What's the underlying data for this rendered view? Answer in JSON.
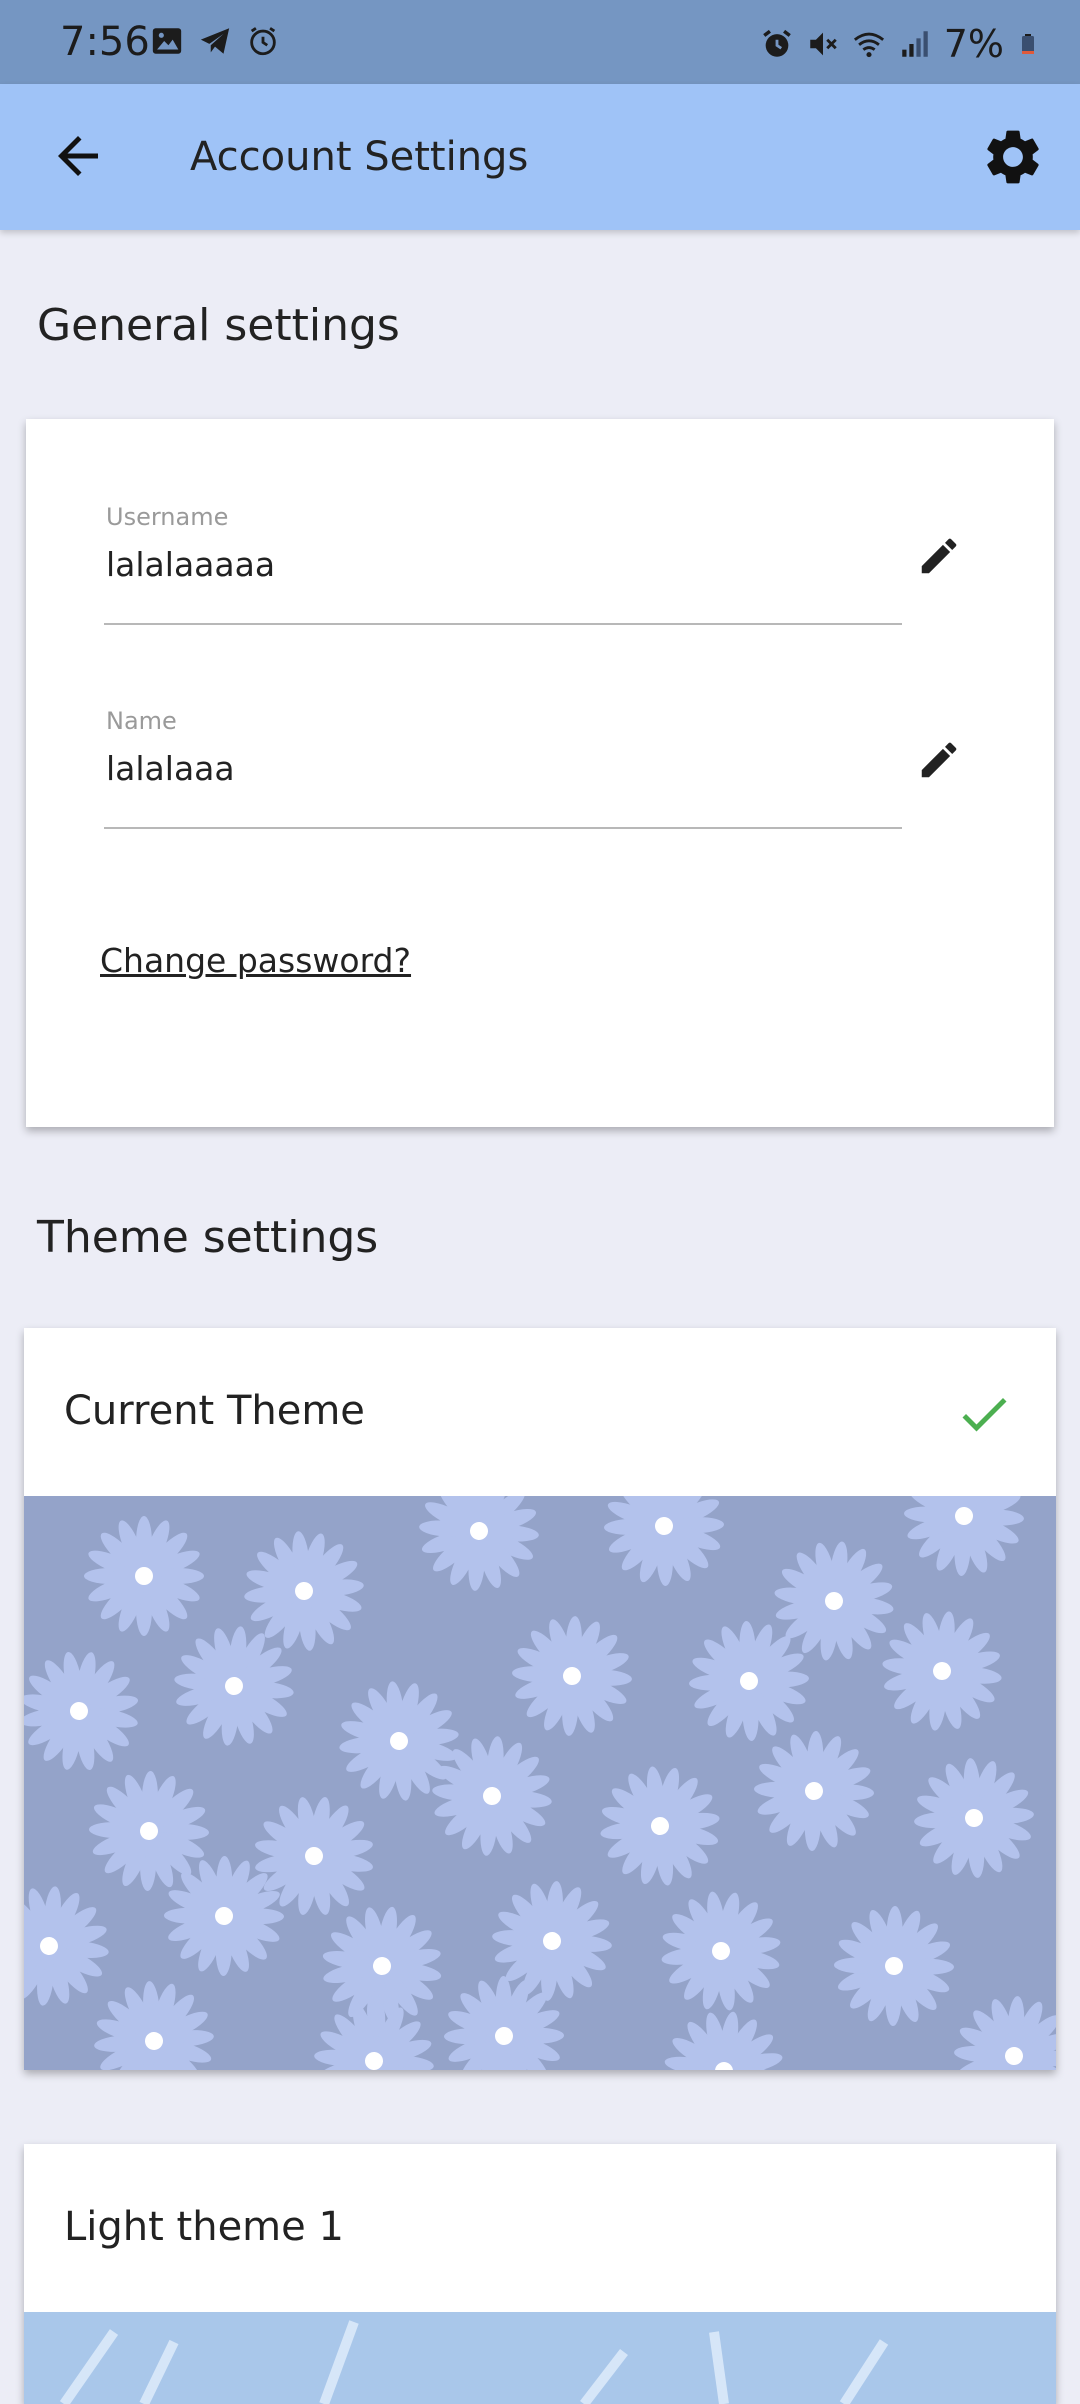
{
  "status_bar": {
    "time": "7:56",
    "battery": "7%",
    "left_icons": [
      "image-icon",
      "telegram-icon",
      "alarm-icon"
    ],
    "right_icons": [
      "alarm-icon",
      "mute-icon",
      "wifi-icon",
      "signal-icon",
      "battery-icon"
    ]
  },
  "app_bar": {
    "title": "Account Settings",
    "back_icon": "arrow-left-icon",
    "settings_icon": "gear-icon"
  },
  "general": {
    "heading": "General settings",
    "username": {
      "label": "Username",
      "value": "lalalaaaaa"
    },
    "name": {
      "label": "Name",
      "value": "lalalaaa"
    },
    "change_password": "Change password?"
  },
  "theme": {
    "heading": "Theme settings",
    "cards": [
      {
        "title": "Current Theme",
        "selected": true
      },
      {
        "title": "Light theme 1",
        "selected": false
      }
    ]
  },
  "colors": {
    "status_bar": "#7596c2",
    "app_bar": "#9fc3f7",
    "background": "#ecedf6",
    "check": "#4caf50",
    "daisy_bg": "#94a3c9",
    "daisy_petal": "#b3c2ec"
  }
}
